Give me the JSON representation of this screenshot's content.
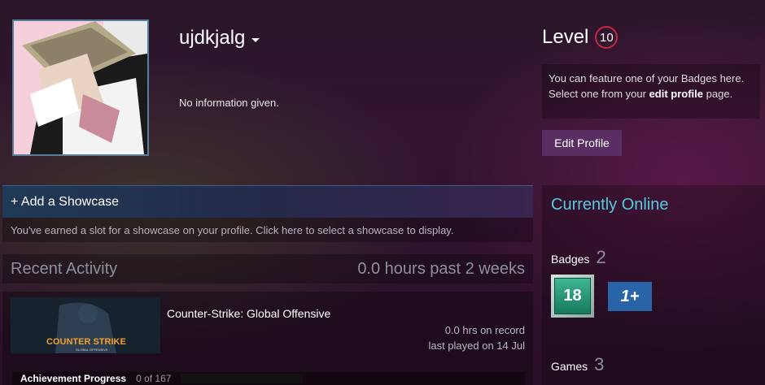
{
  "profile": {
    "persona_name": "ujdkjalg",
    "summary": "No information given."
  },
  "level": {
    "label": "Level",
    "value": "10"
  },
  "featured_badge": {
    "line1": "You can feature one of your Badges here.",
    "line2_prefix": "Select one from your ",
    "line2_link": "edit profile",
    "line2_suffix": " page."
  },
  "edit_profile_button": "Edit Profile",
  "showcase": {
    "title": "+ Add a Showcase",
    "description": "You've earned a slot for a showcase on your profile. Click here to select a showcase to display."
  },
  "recent_activity": {
    "title": "Recent Activity",
    "hours_summary": "0.0 hours past 2 weeks"
  },
  "game": {
    "name": "Counter-Strike: Global Offensive",
    "hours_on_record": "0.0 hrs on record",
    "last_played": "last played on 14 Jul",
    "capsule_logo_text": "COUNTER STRIKE",
    "capsule_logo_sub": "GLOBAL OFFENSIVE",
    "achievement_label": "Achievement Progress",
    "achievement_count": "0 of 167",
    "achievement_fraction": 0
  },
  "sidebar": {
    "status": "Currently Online",
    "badges_label": "Badges",
    "badges_count": "2",
    "badge1_value": "18",
    "badge2_value": "1+",
    "games_label": "Games",
    "games_count": "3"
  },
  "colors": {
    "online_accent": "#57cbde",
    "level_ring": "#c02942",
    "edit_button": "#5a2e63"
  }
}
